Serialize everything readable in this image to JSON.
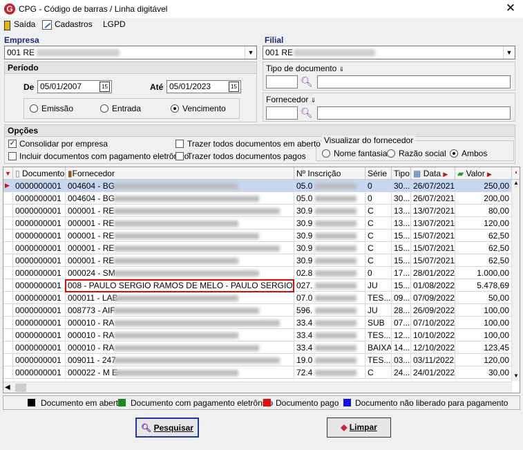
{
  "window": {
    "title": "CPG - Código de barras / Linha digitável",
    "close_glyph": "✕",
    "logo": "G"
  },
  "menu": {
    "saida": "Saída",
    "cadastros": "Cadastros",
    "lgpd": "LGPD"
  },
  "empresa": {
    "label": "Empresa",
    "value": "001 RE"
  },
  "filial": {
    "label": "Filial",
    "value": "001 RE"
  },
  "periodo": {
    "label": "Período",
    "de_label": "De",
    "de_value": "05/01/2007",
    "ate_label": "Até",
    "ate_value": "05/01/2023",
    "cal_icon": "15",
    "radios": [
      "Emissão",
      "Entrada",
      "Vencimento"
    ],
    "selected": "Vencimento"
  },
  "tipo_documento": {
    "label": "Tipo de documento"
  },
  "fornecedor_filter": {
    "label": "Fornecedor"
  },
  "opcoes": {
    "label": "Opções",
    "consolidar": "Consolidar por empresa",
    "incluir_eletronico": "Incluir documentos com pagamento eletrônico",
    "trazer_aberto": "Trazer todos documentos em aberto",
    "trazer_pagos": "Trazer todos documentos pagos",
    "visualizar_label": "Visualizar do fornecedor",
    "visualizar_options": [
      "Nome fantasia",
      "Razão social",
      "Ambos"
    ],
    "visualizar_selected": "Ambos"
  },
  "grid": {
    "columns": [
      "Documento",
      "Fornecedor",
      "Nº Inscrição",
      "Série",
      "Tipo",
      "Data",
      "Valor"
    ],
    "rows": [
      {
        "doc": "0000000001",
        "forn": "004604 - BG",
        "insc": "05.0",
        "serie": "0",
        "tipo": "30...",
        "data": "26/07/2021",
        "valor": "250,00"
      },
      {
        "doc": "0000000001",
        "forn": "004604 - BG",
        "insc": "05.0",
        "serie": "0",
        "tipo": "30...",
        "data": "26/07/2021",
        "valor": "200,00"
      },
      {
        "doc": "0000000001",
        "forn": "000001 - RE",
        "insc": "30.9",
        "serie": "C",
        "tipo": "13...",
        "data": "13/07/2021",
        "valor": "80,00"
      },
      {
        "doc": "0000000001",
        "forn": "000001 - RE",
        "insc": "30.9",
        "serie": "C",
        "tipo": "13...",
        "data": "13/07/2021",
        "valor": "120,00"
      },
      {
        "doc": "0000000001",
        "forn": "000001 - RE",
        "insc": "30.9",
        "serie": "C",
        "tipo": "15...",
        "data": "15/07/2021",
        "valor": "62,50"
      },
      {
        "doc": "0000000001",
        "forn": "000001 - RE",
        "insc": "30.9",
        "serie": "C",
        "tipo": "15...",
        "data": "15/07/2021",
        "valor": "62,50"
      },
      {
        "doc": "0000000001",
        "forn": "000001 - RE",
        "insc": "30.9",
        "serie": "C",
        "tipo": "15...",
        "data": "15/07/2021",
        "valor": "62,50"
      },
      {
        "doc": "0000000001",
        "forn": "000024 - SM",
        "insc": "02.8",
        "serie": "0",
        "tipo": "17...",
        "data": "28/01/2022",
        "valor": "1.000,00"
      },
      {
        "doc": "0000000001",
        "forn": "008     -  PAULO SERGIO RAMOS DE MELO  -  PAULO SERGIO",
        "insc": "027.",
        "serie": "JU",
        "tipo": "15...",
        "data": "01/08/2022",
        "valor": "5.478,69"
      },
      {
        "doc": "0000000001",
        "forn": "000011 - LAB",
        "insc": "07.0",
        "serie": "TES...",
        "tipo": "09...",
        "data": "07/09/2022",
        "valor": "50,00"
      },
      {
        "doc": "0000000001",
        "forn": "008773 - AIF",
        "insc": "596.",
        "serie": "JU",
        "tipo": "28...",
        "data": "26/09/2022",
        "valor": "100,00"
      },
      {
        "doc": "0000000001",
        "forn": "000010 - RA",
        "insc": "33.4",
        "serie": "SUB",
        "tipo": "07...",
        "data": "07/10/2022",
        "valor": "100,00"
      },
      {
        "doc": "0000000001",
        "forn": "000010 - RA",
        "insc": "33.4",
        "serie": "TES...",
        "tipo": "12...",
        "data": "10/10/2022",
        "valor": "100,00"
      },
      {
        "doc": "0000000001",
        "forn": "000010 - RA",
        "insc": "33.4",
        "serie": "BAIXA",
        "tipo": "14...",
        "data": "12/10/2022",
        "valor": "123,45"
      },
      {
        "doc": "0000000001",
        "forn": "009011 - 247",
        "insc": "19.0",
        "serie": "TES...",
        "tipo": "03...",
        "data": "03/11/2022",
        "valor": "120,00"
      },
      {
        "doc": "0000000001",
        "forn": "000022 - M E",
        "insc": "72.4",
        "serie": "C",
        "tipo": "24...",
        "data": "24/01/2022",
        "valor": "30,00"
      }
    ]
  },
  "legend": {
    "aberto": "Documento em aberto",
    "eletronico": "Documento com pagamento eletrônico",
    "pago": "Documento pago",
    "nao_liberado": "Documento não liberado para pagamento",
    "colors": {
      "aberto": "#000000",
      "eletronico": "#1a8a1a",
      "pago": "#e01010",
      "nao_liberado": "#1010e0"
    }
  },
  "buttons": {
    "pesquisar": "Pesquisar",
    "limpar": "Limpar"
  },
  "colors": {
    "selected_row": "#c6d7f0",
    "highlight_box": "#d01010",
    "group_label": "#1a2a80"
  }
}
